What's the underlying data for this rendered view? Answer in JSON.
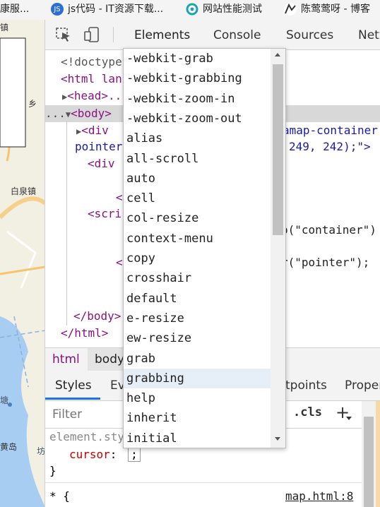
{
  "bookmarks": [
    {
      "label": "康服...",
      "icon": "bookmark-favicon"
    },
    {
      "label": "js代码 - IT资源下载...",
      "icon": "js-favicon",
      "icon_text": "JS"
    },
    {
      "label": "网站性能测试",
      "icon": "webperf-favicon"
    },
    {
      "label": "陈莺莺呀 - 博客",
      "icon": "blog-favicon"
    }
  ],
  "map": {
    "labels": [
      "镇",
      "白泉镇",
      "乡",
      "塘",
      "黄岛",
      "坊"
    ]
  },
  "devtools": {
    "tabs": [
      "Elements",
      "Console",
      "Sources",
      "Netw"
    ],
    "dom": {
      "doctype": "<!doctype",
      "html_open": "<html lan",
      "head": "<head>...",
      "body_open": "<body>",
      "div1_left": "<div",
      "div1_attr_right": "amap-container",
      "div1_cont_left": "pointer",
      "div1_cont_right": "249, 242);\">",
      "div2_left": "<div",
      "lt1": "<",
      "script_left": "<scri",
      "script_right1": "p(\"container\")",
      "lt2": "<",
      "script_right2": "r(\"pointer\");",
      "body_close": "</body>",
      "html_close": "</html>",
      "ellipsis": "..."
    },
    "breadcrumbs": [
      "html",
      "body"
    ],
    "subtabs": [
      "Styles",
      "Ev",
      "tpoints",
      "Proper"
    ],
    "filter_placeholder": "Filter",
    "cls_label": ".cls",
    "plus_label": "+",
    "styles": {
      "selector": "element.sty",
      "property": "cursor",
      "colon": ":",
      "semicolon": ";",
      "close_brace": "}",
      "universal": "* {",
      "source_link": "map.html:8"
    }
  },
  "autocomplete": {
    "options": [
      "-webkit-grab",
      "-webkit-grabbing",
      "-webkit-zoom-in",
      "-webkit-zoom-out",
      "alias",
      "all-scroll",
      "auto",
      "cell",
      "col-resize",
      "context-menu",
      "copy",
      "crosshair",
      "default",
      "e-resize",
      "ew-resize",
      "grab",
      "grabbing",
      "help",
      "inherit",
      "initial"
    ],
    "selected": "grabbing"
  },
  "colors": {
    "selection": "#e6eef8",
    "accent": "#1a73e8"
  }
}
